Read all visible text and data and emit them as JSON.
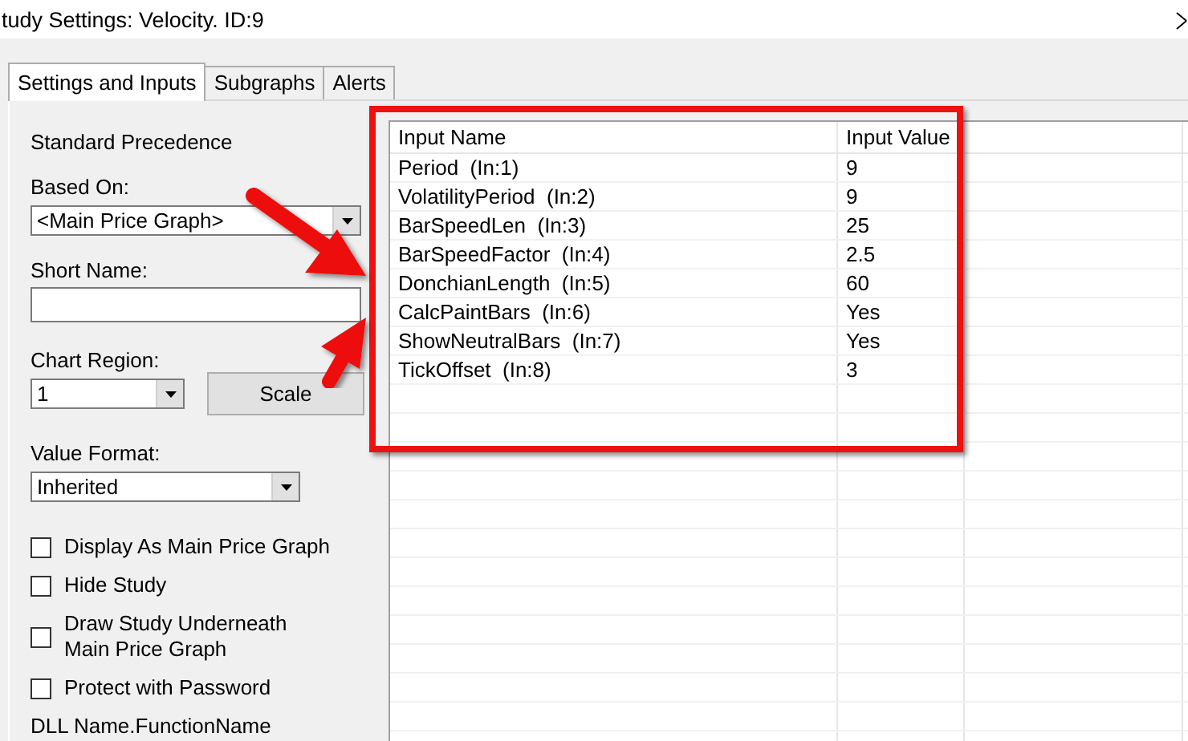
{
  "window": {
    "title": "tudy Settings: Velocity. ID:9"
  },
  "tabs": [
    {
      "label": "Settings and Inputs",
      "selected": true
    },
    {
      "label": "Subgraphs",
      "selected": false
    },
    {
      "label": "Alerts",
      "selected": false
    }
  ],
  "settings": {
    "precedence_label": "Standard Precedence",
    "based_on": {
      "label": "Based On:",
      "value": "<Main Price Graph>"
    },
    "short_name": {
      "label": "Short Name:"
    },
    "chart_region": {
      "label": "Chart Region:",
      "value": "1"
    },
    "scale_button": "Scale",
    "value_format": {
      "label": "Value Format:",
      "value": "Inherited"
    },
    "options": [
      {
        "label": "Display As Main Price Graph",
        "checked": false
      },
      {
        "label": "Hide Study",
        "checked": false
      },
      {
        "label": "Draw Study Underneath Main Price Graph",
        "checked": false
      },
      {
        "label": "Protect with Password",
        "checked": false
      }
    ],
    "dll_label": "DLL Name.FunctionName"
  },
  "inputs_table": {
    "columns": [
      "Input Name",
      "Input Value"
    ],
    "rows": [
      {
        "name": "Period  (In:1)",
        "value": "9"
      },
      {
        "name": "VolatilityPeriod  (In:2)",
        "value": "9"
      },
      {
        "name": "BarSpeedLen  (In:3)",
        "value": "25"
      },
      {
        "name": "BarSpeedFactor  (In:4)",
        "value": "2.5"
      },
      {
        "name": "DonchianLength  (In:5)",
        "value": "60"
      },
      {
        "name": "CalcPaintBars  (In:6)",
        "value": "Yes"
      },
      {
        "name": "ShowNeutralBars  (In:7)",
        "value": "Yes"
      },
      {
        "name": "TickOffset  (In:8)",
        "value": "3"
      }
    ]
  }
}
